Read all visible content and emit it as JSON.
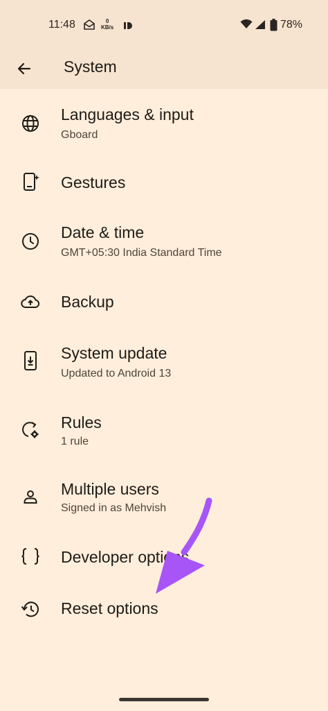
{
  "status_bar": {
    "time": "11:48",
    "speed_top": "0",
    "speed_bottom": "KB/s",
    "battery": "78%"
  },
  "app_bar": {
    "title": "System"
  },
  "items": [
    {
      "title": "Languages & input",
      "subtitle": "Gboard",
      "icon": "globe-icon"
    },
    {
      "title": "Gestures",
      "subtitle": "",
      "icon": "gestures-phone-icon"
    },
    {
      "title": "Date & time",
      "subtitle": "GMT+05:30 India Standard Time",
      "icon": "clock-icon"
    },
    {
      "title": "Backup",
      "subtitle": "",
      "icon": "cloud-upload-icon"
    },
    {
      "title": "System update",
      "subtitle": "Updated to Android 13",
      "icon": "system-update-icon"
    },
    {
      "title": "Rules",
      "subtitle": "1 rule",
      "icon": "rules-icon"
    },
    {
      "title": "Multiple users",
      "subtitle": "Signed in as Mehvish",
      "icon": "person-icon"
    },
    {
      "title": "Developer options",
      "subtitle": "",
      "icon": "braces-icon"
    },
    {
      "title": "Reset options",
      "subtitle": "",
      "icon": "history-icon"
    }
  ],
  "colors": {
    "background": "#FFEEDC",
    "app_bar": "#F7E4D0",
    "annotation_arrow": "#A855F7"
  }
}
